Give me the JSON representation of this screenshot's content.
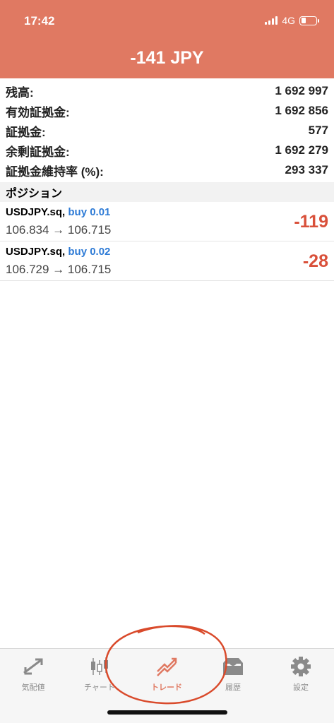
{
  "status_bar": {
    "time": "17:42",
    "network": "4G"
  },
  "header": {
    "total": "-141 JPY"
  },
  "account": [
    {
      "label": "残高:",
      "value": "1 692 997"
    },
    {
      "label": "有効証拠金:",
      "value": "1 692 856"
    },
    {
      "label": "証拠金:",
      "value": "577"
    },
    {
      "label": "余剰証拠金:",
      "value": "1 692 279"
    },
    {
      "label": "証拠金維持率 (%):",
      "value": "293 337"
    }
  ],
  "positions_header": "ポジション",
  "positions": [
    {
      "symbol": "USDJPY.sq,",
      "direction": "buy 0.01",
      "prices": "106.834 → 106.715",
      "profit": "-119"
    },
    {
      "symbol": "USDJPY.sq,",
      "direction": "buy 0.02",
      "prices": "106.729 → 106.715",
      "profit": "-28"
    }
  ],
  "tabs": [
    {
      "label": "気配値",
      "icon": "quotes-icon"
    },
    {
      "label": "チャート",
      "icon": "chart-icon"
    },
    {
      "label": "トレード",
      "icon": "trade-icon",
      "active": true
    },
    {
      "label": "履歴",
      "icon": "history-icon"
    },
    {
      "label": "設定",
      "icon": "settings-icon"
    }
  ],
  "colors": {
    "header": "#e07962",
    "loss": "#d9503a",
    "buy": "#2e7bd6",
    "annotation": "#d94a2b"
  }
}
